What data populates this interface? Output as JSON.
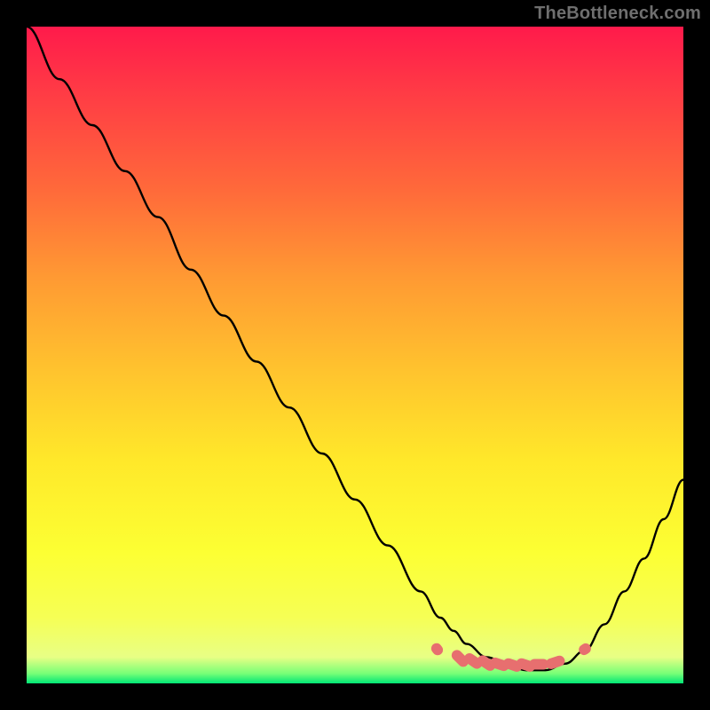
{
  "watermark": "TheBottleneck.com",
  "colors": {
    "frame": "#000000",
    "curve_stroke": "#000000",
    "marker_fill": "#e76f6f",
    "marker_stroke": "#c94b4b",
    "gradient": [
      "#ff1a4b",
      "#ff3b45",
      "#ff6a3a",
      "#ff9933",
      "#ffc22e",
      "#ffe82a",
      "#fcff33",
      "#f6ff55",
      "#e8ff85",
      "#77ff77",
      "#00e676"
    ]
  },
  "chart_data": {
    "type": "line",
    "title": "",
    "xlabel": "",
    "ylabel": "",
    "xlim": [
      0,
      100
    ],
    "ylim": [
      0,
      100
    ],
    "grid": false,
    "legend": false,
    "series": [
      {
        "name": "bottleneck-curve",
        "x": [
          0,
          5,
          10,
          15,
          20,
          25,
          30,
          35,
          40,
          45,
          50,
          55,
          60,
          63,
          65,
          67,
          70,
          73,
          76,
          79,
          82,
          85,
          88,
          91,
          94,
          97,
          100
        ],
        "values": [
          100,
          92,
          85,
          78,
          71,
          63,
          56,
          49,
          42,
          35,
          28,
          21,
          14,
          10,
          8,
          6,
          4,
          3,
          2,
          2,
          3,
          5,
          9,
          14,
          19,
          25,
          31
        ]
      }
    ],
    "markers": {
      "name": "highlight-dots",
      "x": [
        62.5,
        66,
        68,
        70,
        72,
        74,
        76,
        78,
        80.5,
        85
      ],
      "values": [
        5.2,
        3.8,
        3.4,
        3.1,
        2.9,
        2.8,
        2.8,
        2.9,
        3.2,
        5.2
      ]
    }
  }
}
